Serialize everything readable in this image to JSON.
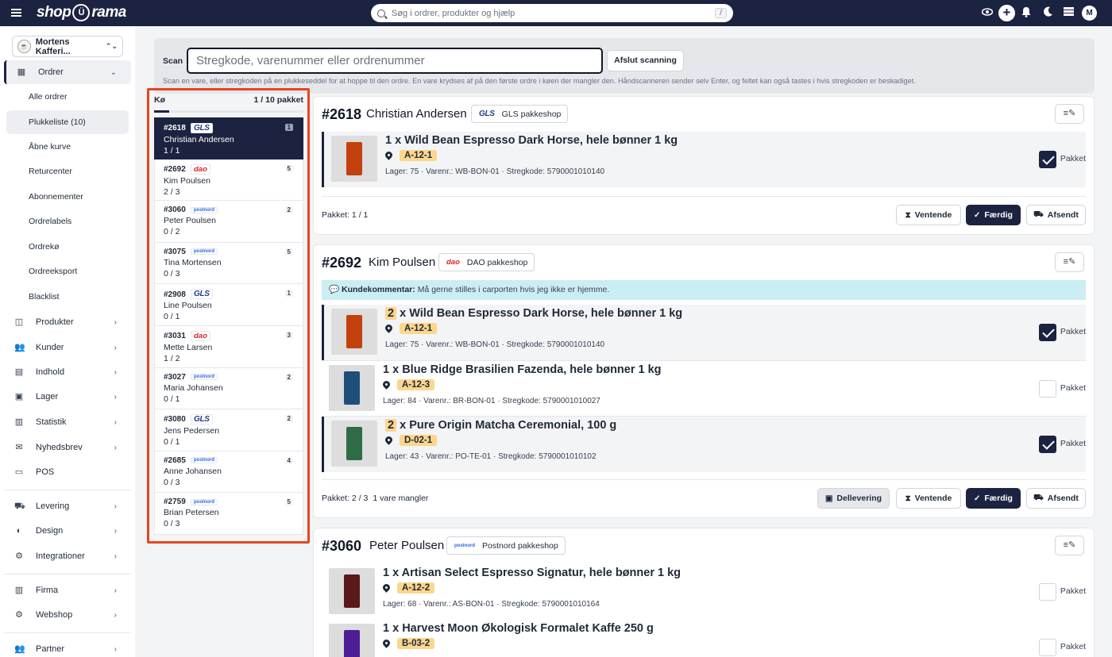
{
  "topbar": {
    "brand_left": "shop",
    "brand_mark": "Ü",
    "brand_right": "rama",
    "search_placeholder": "Søg i ordrer, produkter og hjælp",
    "search_shortcut": "/",
    "user_initial": "M",
    "plus": "+"
  },
  "sidebar": {
    "store_name": "Mortens Kafferi...",
    "orders_label": "Ordrer",
    "order_subitems": [
      "Alle ordrer",
      "Plukkeliste (10)",
      "Åbne kurve",
      "Returcenter",
      "Abonnementer",
      "Ordrelabels",
      "Ordrekø",
      "Ordreeksport",
      "Blacklist"
    ],
    "sections": [
      "Produkter",
      "Kunder",
      "Indhold",
      "Lager",
      "Statistik",
      "Nyhedsbrev",
      "POS"
    ],
    "sections2": [
      "Levering",
      "Design",
      "Integrationer"
    ],
    "sections3": [
      "Firma",
      "Webshop"
    ],
    "sections4": [
      "Partner"
    ]
  },
  "scan": {
    "label": "Scan",
    "placeholder": "Stregkode, varenummer eller ordrenummer",
    "finish_button": "Afslut scanning",
    "help": "Scan en vare, eller stregkoden på en plukkeseddel for at hoppe til den ordre. En vare krydses af på den første ordre i køen der mangler den. Håndscanneren sender selv Enter, og feltet kan også tastes i hvis stregkoden er beskadiget."
  },
  "queue": {
    "title": "Kø",
    "count": "1 / 10 pakket",
    "progress_fraction": 0.1,
    "items": [
      {
        "num": "#2618",
        "carrier": "GLS",
        "ctype": "gls",
        "name": "Christian Andersen",
        "progress": "1 / 1",
        "qty": "1",
        "active": true
      },
      {
        "num": "#2692",
        "carrier": "dao",
        "ctype": "dao",
        "name": "Kim Poulsen",
        "progress": "2 / 3",
        "qty": "5",
        "active": false
      },
      {
        "num": "#3060",
        "carrier": "postnord",
        "ctype": "post",
        "name": "Peter Poulsen",
        "progress": "0 / 2",
        "qty": "2",
        "active": false
      },
      {
        "num": "#3075",
        "carrier": "postnord",
        "ctype": "post",
        "name": "Tina Mortensen",
        "progress": "0 / 3",
        "qty": "5",
        "active": false
      },
      {
        "num": "#2908",
        "carrier": "GLS",
        "ctype": "gls",
        "name": "Line Poulsen",
        "progress": "0 / 1",
        "qty": "1",
        "active": false
      },
      {
        "num": "#3031",
        "carrier": "dao",
        "ctype": "dao",
        "name": "Mette Larsen",
        "progress": "1 / 2",
        "qty": "3",
        "active": false
      },
      {
        "num": "#3027",
        "carrier": "postnord",
        "ctype": "post",
        "name": "Maria Johansen",
        "progress": "0 / 1",
        "qty": "2",
        "active": false
      },
      {
        "num": "#3080",
        "carrier": "GLS",
        "ctype": "gls",
        "name": "Jens Pedersen",
        "progress": "0 / 1",
        "qty": "2",
        "active": false
      },
      {
        "num": "#2685",
        "carrier": "postnord",
        "ctype": "post",
        "name": "Anne Johansen",
        "progress": "0 / 3",
        "qty": "4",
        "active": false
      },
      {
        "num": "#2759",
        "carrier": "postnord",
        "ctype": "post",
        "name": "Brian Petersen",
        "progress": "0 / 3",
        "qty": "5",
        "active": false
      }
    ]
  },
  "orders": [
    {
      "num": "#2618",
      "name": "Christian Andersen",
      "carrier": "GLS",
      "ship": "GLS pakkeshop",
      "items": [
        {
          "qty": "1",
          "title": "x Wild Bean Espresso Dark Horse, hele bønner 1 kg",
          "loc": "A-12-1",
          "meta": "Lager: 75 · Varenr.: WB-BON-01 · Stregkode: 5790001010140",
          "packed": true,
          "label": "Pakket",
          "color": "#c2410c"
        }
      ],
      "footer": "Pakket: 1 / 1",
      "footer_note": "",
      "buttons": {
        "wait": "Ventende",
        "done": "Færdig",
        "sent": "Afsendt"
      }
    },
    {
      "num": "#2692",
      "name": "Kim Poulsen",
      "carrier": "dao",
      "ship": "DAO pakkeshop",
      "comment_label": "Kundekommentar:",
      "comment": "Må gerne stilles i carporten hvis jeg ikke er hjemme.",
      "items": [
        {
          "qty": "2",
          "title": "x Wild Bean Espresso Dark Horse, hele bønner 1 kg",
          "loc": "A-12-1",
          "meta": "Lager: 75 · Varenr.: WB-BON-01 · Stregkode: 5790001010140",
          "packed": true,
          "label": "Pakket",
          "color": "#c2410c"
        },
        {
          "qty": "1",
          "title": "x Blue Ridge Brasilien Fazenda, hele bønner 1 kg",
          "loc": "A-12-3",
          "meta": "Lager: 84 · Varenr.: BR-BON-01 · Stregkode: 5790001010027",
          "packed": false,
          "label": "Pakket",
          "color": "#1e4f7a"
        },
        {
          "qty": "2",
          "title": "x Pure Origin Matcha Ceremonial, 100 g",
          "loc": "D-02-1",
          "meta": "Lager: 43 · Varenr.: PO-TE-01 · Stregkode: 5790001010102",
          "packed": true,
          "label": "Pakket",
          "color": "#2f6b45"
        }
      ],
      "footer": "Pakket: 2 / 3",
      "footer_note": "1 vare mangler",
      "buttons": {
        "partial": "Dellevering",
        "wait": "Ventende",
        "done": "Færdig",
        "sent": "Afsendt"
      }
    },
    {
      "num": "#3060",
      "name": "Peter Poulsen",
      "carrier": "postnord",
      "ship": "Postnord pakkeshop",
      "items": [
        {
          "qty": "1",
          "title": "x Artisan Select Espresso Signatur, hele bønner 1 kg",
          "loc": "A-12-2",
          "meta": "Lager: 68 · Varenr.: AS-BON-01 · Stregkode: 5790001010164",
          "packed": false,
          "label": "Pakket",
          "color": "#5b1a1a"
        },
        {
          "qty": "1",
          "title": "x Harvest Moon Økologisk Formalet Kaffe 250 g",
          "loc": "B-03-2",
          "meta": "",
          "packed": false,
          "label": "Pakket",
          "color": "#4c1d95"
        }
      ]
    }
  ]
}
